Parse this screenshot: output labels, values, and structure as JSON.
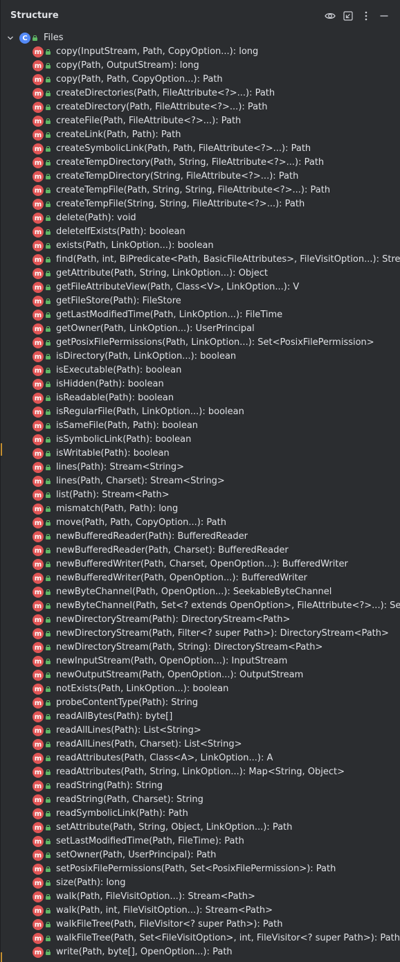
{
  "header": {
    "title": "Structure",
    "buttons": [
      {
        "name": "eye-icon"
      },
      {
        "name": "navigate-icon"
      },
      {
        "name": "more-options-icon"
      },
      {
        "name": "minimize-icon"
      }
    ]
  },
  "tree": {
    "root": {
      "icon": "class-icon",
      "icon_letter": "C",
      "label": "Files"
    },
    "method_icon_letter": "m",
    "items": [
      "copy(InputStream, Path, CopyOption...): long",
      "copy(Path, OutputStream): long",
      "copy(Path, Path, CopyOption...): Path",
      "createDirectories(Path, FileAttribute<?>...): Path",
      "createDirectory(Path, FileAttribute<?>...): Path",
      "createFile(Path, FileAttribute<?>...): Path",
      "createLink(Path, Path): Path",
      "createSymbolicLink(Path, Path, FileAttribute<?>...): Path",
      "createTempDirectory(Path, String, FileAttribute<?>...): Path",
      "createTempDirectory(String, FileAttribute<?>...): Path",
      "createTempFile(Path, String, String, FileAttribute<?>...): Path",
      "createTempFile(String, String, FileAttribute<?>...): Path",
      "delete(Path): void",
      "deleteIfExists(Path): boolean",
      "exists(Path, LinkOption...): boolean",
      "find(Path, int, BiPredicate<Path, BasicFileAttributes>, FileVisitOption...): Stream",
      "getAttribute(Path, String, LinkOption...): Object",
      "getFileAttributeView(Path, Class<V>, LinkOption...): V",
      "getFileStore(Path): FileStore",
      "getLastModifiedTime(Path, LinkOption...): FileTime",
      "getOwner(Path, LinkOption...): UserPrincipal",
      "getPosixFilePermissions(Path, LinkOption...): Set<PosixFilePermission>",
      "isDirectory(Path, LinkOption...): boolean",
      "isExecutable(Path): boolean",
      "isHidden(Path): boolean",
      "isReadable(Path): boolean",
      "isRegularFile(Path, LinkOption...): boolean",
      "isSameFile(Path, Path): boolean",
      "isSymbolicLink(Path): boolean",
      "isWritable(Path): boolean",
      "lines(Path): Stream<String>",
      "lines(Path, Charset): Stream<String>",
      "list(Path): Stream<Path>",
      "mismatch(Path, Path): long",
      "move(Path, Path, CopyOption...): Path",
      "newBufferedReader(Path): BufferedReader",
      "newBufferedReader(Path, Charset): BufferedReader",
      "newBufferedWriter(Path, Charset, OpenOption...): BufferedWriter",
      "newBufferedWriter(Path, OpenOption...): BufferedWriter",
      "newByteChannel(Path, OpenOption...): SeekableByteChannel",
      "newByteChannel(Path, Set<? extends OpenOption>, FileAttribute<?>...): Seek",
      "newDirectoryStream(Path): DirectoryStream<Path>",
      "newDirectoryStream(Path, Filter<? super Path>): DirectoryStream<Path>",
      "newDirectoryStream(Path, String): DirectoryStream<Path>",
      "newInputStream(Path, OpenOption...): InputStream",
      "newOutputStream(Path, OpenOption...): OutputStream",
      "notExists(Path, LinkOption...): boolean",
      "probeContentType(Path): String",
      "readAllBytes(Path): byte[]",
      "readAllLines(Path): List<String>",
      "readAllLines(Path, Charset): List<String>",
      "readAttributes(Path, Class<A>, LinkOption...): A",
      "readAttributes(Path, String, LinkOption...): Map<String, Object>",
      "readString(Path): String",
      "readString(Path, Charset): String",
      "readSymbolicLink(Path): Path",
      "setAttribute(Path, String, Object, LinkOption...): Path",
      "setLastModifiedTime(Path, FileTime): Path",
      "setOwner(Path, UserPrincipal): Path",
      "setPosixFilePermissions(Path, Set<PosixFilePermission>): Path",
      "size(Path): long",
      "walk(Path, FileVisitOption...): Stream<Path>",
      "walk(Path, int, FileVisitOption...): Stream<Path>",
      "walkFileTree(Path, FileVisitor<? super Path>): Path",
      "walkFileTree(Path, Set<FileVisitOption>, int, FileVisitor<? super Path>): Path",
      "write(Path, byte[], OpenOption...): Path"
    ]
  },
  "colors": {
    "background": "#2b2d30",
    "text": "#dfe1e5",
    "method_icon": "#e05555",
    "class_icon": "#548af7",
    "lock": "#5fb865"
  }
}
